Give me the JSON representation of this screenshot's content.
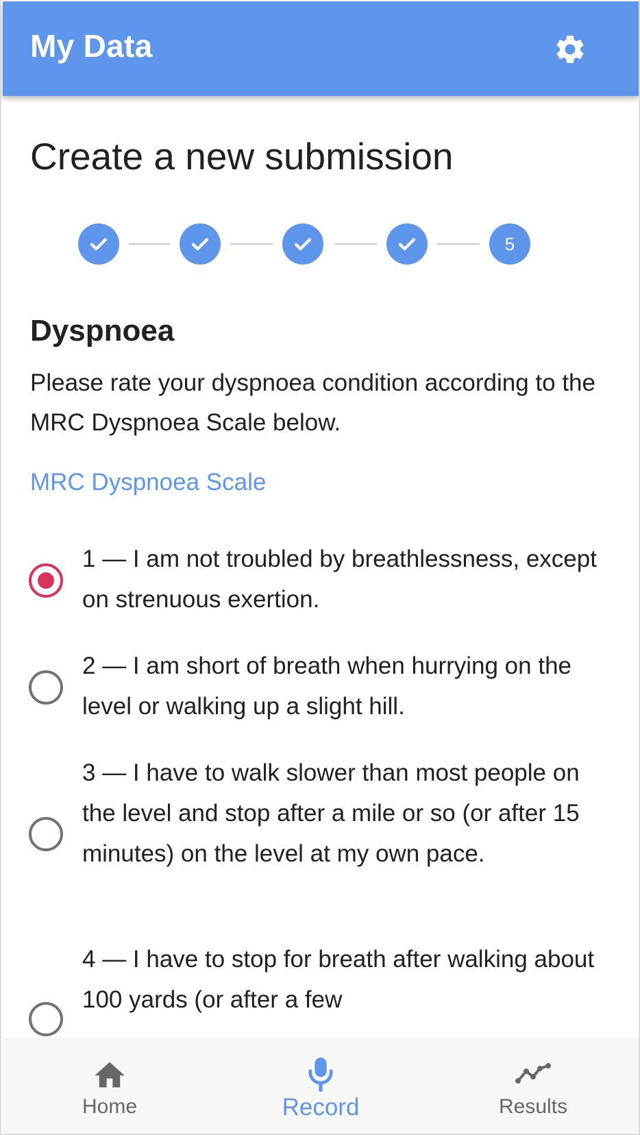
{
  "app_bar": {
    "title": "My Data",
    "settings_icon": "gear-icon",
    "background_color": "#5e96ec"
  },
  "page": {
    "title": "Create a new submission"
  },
  "stepper": {
    "total_steps": 5,
    "current_step": 5,
    "completed_steps": [
      1,
      2,
      3,
      4
    ],
    "current_step_label": "5"
  },
  "section": {
    "title": "Dyspnoea",
    "description": "Please rate your dyspnoea condition according to the MRC Dyspnoea Scale below.",
    "link_label": "MRC Dyspnoea Scale"
  },
  "options": [
    {
      "label": "1 — I am not troubled by breathlessness, except on strenuous exertion.",
      "selected": true
    },
    {
      "label": "2 — I am short of breath when hurrying on the level or walking up a slight hill.",
      "selected": false
    },
    {
      "label": "3 — I have to walk slower than most people on the level and stop after a mile or so (or after 15 minutes) on the level at my own pace.",
      "selected": false
    },
    {
      "label": "4 — I have to stop for breath after walking about 100 yards (or after a few",
      "selected": false
    }
  ],
  "bottom_nav": {
    "items": [
      {
        "label": "Home",
        "icon": "home-icon",
        "active": false
      },
      {
        "label": "Record",
        "icon": "microphone-icon",
        "active": true
      },
      {
        "label": "Results",
        "icon": "trend-chart-icon",
        "active": false
      }
    ],
    "active_color": "#5e96ec",
    "selected_radio_color": "#d8345f"
  }
}
